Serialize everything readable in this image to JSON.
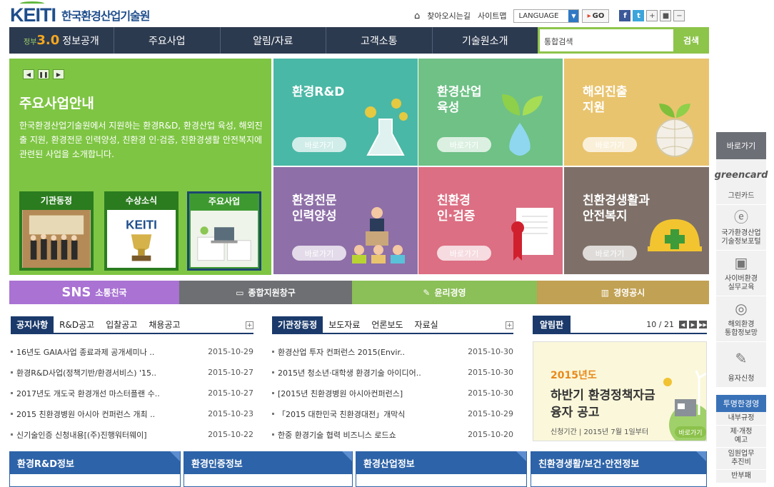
{
  "header": {
    "logo_text": "KEITI",
    "org_name": "한국환경산업기술원",
    "links": [
      "찾아오시는길",
      "사이트맵"
    ],
    "language_label": "LANGUAGE",
    "go_label": "GO",
    "social": [
      "f",
      "t"
    ]
  },
  "nav": {
    "gov_prefix": "정부",
    "gov_num": "3.0",
    "items": [
      "정보공개",
      "주요사업",
      "알림/자료",
      "고객소통",
      "기술원소개"
    ]
  },
  "search": {
    "placeholder": "통합검색",
    "button": "검색"
  },
  "hero": {
    "title": "주요사업안내",
    "desc": "한국환경산업기술원에서 지원하는 환경R&D, 환경산업 육성, 해외진출 지원, 환경전문 인력양성, 친환경 인·검증, 친환경생활 안전복지에 관련된 사업을 소개합니다.",
    "thumbs": [
      "기관동정",
      "수상소식",
      "주요사업"
    ]
  },
  "tiles": [
    {
      "title": "환경R&D",
      "button": "바로가기",
      "color": "#4ab8a6"
    },
    {
      "title": "환경산업\n육성",
      "button": "바로가기",
      "color": "#6fc186"
    },
    {
      "title": "해외진출\n지원",
      "button": "바로가기",
      "color": "#e9c46e"
    },
    {
      "title": "환경전문\n인력양성",
      "button": "바로가기",
      "color": "#8e6fa8"
    },
    {
      "title": "친환경\n인·검증",
      "button": "바로가기",
      "color": "#dc6f83"
    },
    {
      "title": "친환경생활과\n안전복지",
      "button": "바로가기",
      "color": "#7e7068"
    }
  ],
  "bars": [
    {
      "big": "SNS",
      "label": "소통친국",
      "color": "#a972d3"
    },
    {
      "label": "종합지원창구",
      "color": "#6d6f72"
    },
    {
      "label": "윤리경영",
      "color": "#8bbf57"
    },
    {
      "label": "경영공시",
      "color": "#c1a153"
    }
  ],
  "board1": {
    "tabs": [
      "공지사항",
      "R&D공고",
      "입찰공고",
      "채용공고"
    ],
    "rows": [
      {
        "title": "16년도 GAIA사업 종료과제 공개세미나 ..",
        "date": "2015-10-29"
      },
      {
        "title": "환경R&D사업(정책기반/환경서비스) '15..",
        "date": "2015-10-27"
      },
      {
        "title": "2017년도 개도국 환경개선 마스터플랜 수..",
        "date": "2015-10-27"
      },
      {
        "title": "2015 친환경병원 아시아 컨퍼런스 개최 ..",
        "date": "2015-10-23"
      },
      {
        "title": "신기술인증 신청내용[(주)진행워터웨이]",
        "date": "2015-10-22"
      }
    ]
  },
  "board2": {
    "tabs": [
      "기관장동정",
      "보도자료",
      "언론보도",
      "자료실"
    ],
    "rows": [
      {
        "title": "환경산업 투자 컨퍼런스 2015(Envir..",
        "date": "2015-10-30"
      },
      {
        "title": "2015년 청소년·대학생 환경기술 아이디어..",
        "date": "2015-10-30"
      },
      {
        "title": "[2015년 친환경병원 아시아컨퍼런스]",
        "date": "2015-10-30"
      },
      {
        "title": "「2015 대한민국 친환경대전」개막식",
        "date": "2015-10-29"
      },
      {
        "title": "한중 환경기술 협력 비즈니스 로드쇼",
        "date": "2015-10-20"
      }
    ]
  },
  "notice": {
    "title": "알림판",
    "page": "10 / 21",
    "banner_year": "2015년도",
    "banner_line1": "하반기 환경정책자금",
    "banner_line2": "융자 공고",
    "banner_sub": "신청기간 | 2015년 7월 1일부터",
    "banner_btn": "바로가기"
  },
  "bottom_tabs": [
    "환경R&D정보",
    "환경인증정보",
    "환경산업정보",
    "친환경생활/보건·안전정보"
  ],
  "side": {
    "title": "바로가기",
    "items": [
      {
        "icon": "greencard-icon",
        "logo": "greencard",
        "label": "그린카드"
      },
      {
        "icon": "e-icon",
        "label": "국가환경산업\n기술정보포털"
      },
      {
        "icon": "e-learning-icon",
        "label": "사이버환경\n실무교육"
      },
      {
        "icon": "globe-icon",
        "label": "해외환경\n통합정보망"
      },
      {
        "icon": "form-icon",
        "label": "융자신청"
      }
    ],
    "title2": "투명한경영",
    "links": [
      "내부규정",
      "제·개정\n예고",
      "임원업무\n추진비",
      "반부패"
    ]
  }
}
